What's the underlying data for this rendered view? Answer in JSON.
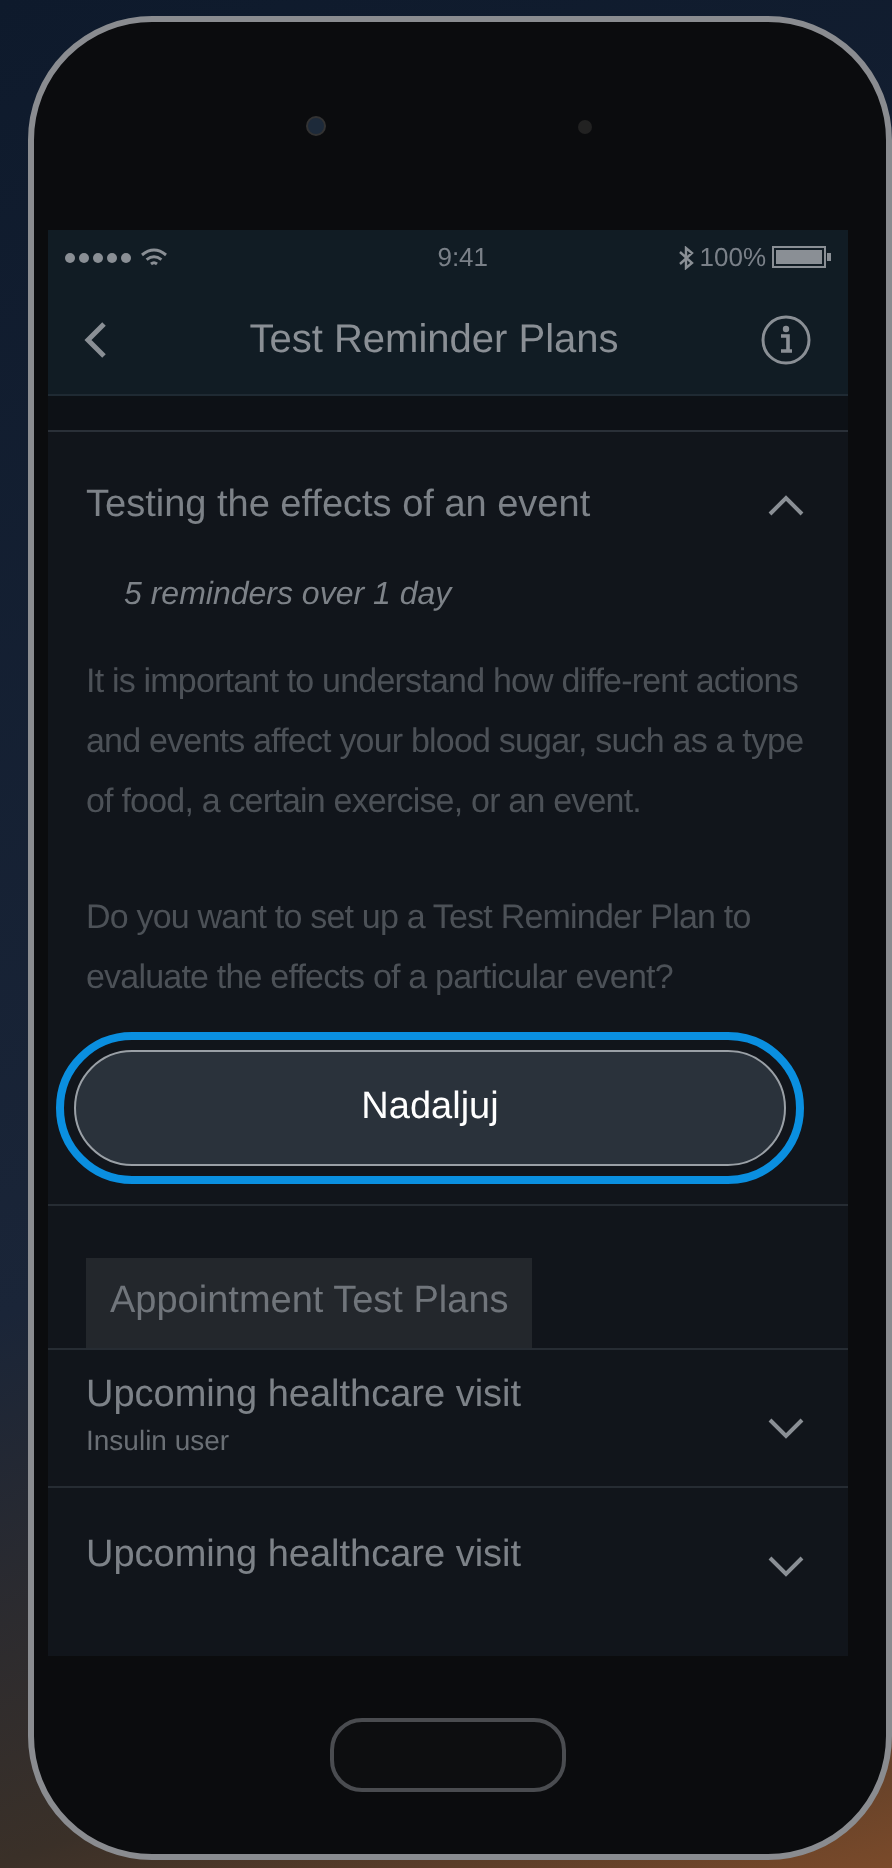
{
  "status_bar": {
    "time": "9:41",
    "battery": "100%"
  },
  "nav": {
    "title": "Test Reminder Plans"
  },
  "plan": {
    "title": "Testing the effects of an event",
    "expanded": true,
    "subtitle": "5 reminders over 1 day",
    "paragraphs": [
      "It is important to understand how diffe-rent actions and events affect your blood sugar, such as a type of food, a certain exercise, or an event.",
      "Do you want to set up a Test Reminder Plan to evaluate the effects of a particular event?"
    ],
    "button": "Nadaljuj"
  },
  "appointment_section": {
    "heading": "Appointment Test Plans",
    "items": [
      {
        "title": "Upcoming healthcare visit",
        "subtitle": "Insulin user",
        "expanded": false
      },
      {
        "title": "Upcoming healthcare visit",
        "expanded": false
      }
    ]
  }
}
